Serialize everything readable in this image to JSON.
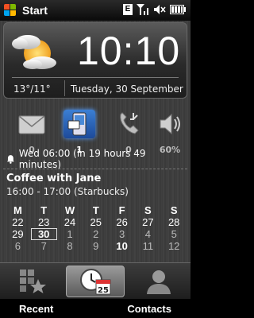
{
  "status_bar": {
    "start_label": "Start",
    "network_badge": "E",
    "icons": [
      "windows-logo",
      "network-badge",
      "signal-icon",
      "volume-icon",
      "battery-icon"
    ]
  },
  "clock": {
    "time": "10:10",
    "temperature": "13°/11°",
    "date": "Tuesday, 30 September",
    "weather_icon": "partly-cloudy-icon"
  },
  "notifications": [
    {
      "name": "email",
      "icon": "email-icon",
      "count": "0"
    },
    {
      "name": "messages",
      "icon": "sms-icon",
      "count": "1"
    },
    {
      "name": "missed-calls",
      "icon": "phone-icon",
      "count": "0"
    },
    {
      "name": "volume",
      "icon": "speaker-icon",
      "count": "60%"
    }
  ],
  "alarm": {
    "text": "Wed 06:00 (in 19 hours 49 minutes)",
    "icon": "bell-icon"
  },
  "appointment": {
    "title": "Coffee with Jane",
    "time": "16:00 - 17:00 (Starbucks)"
  },
  "calendar": {
    "weekdays": [
      "M",
      "T",
      "W",
      "T",
      "F",
      "S",
      "S"
    ],
    "weeks": [
      [
        "22",
        "23",
        "24",
        "25",
        "26",
        "27",
        "28"
      ],
      [
        "29",
        "30",
        "1",
        "2",
        "3",
        "4",
        "5"
      ],
      [
        "6",
        "7",
        "8",
        "9",
        "10",
        "11",
        "12"
      ]
    ],
    "today": "30"
  },
  "tabs": [
    {
      "name": "favorites",
      "icon": "grid-star-icon"
    },
    {
      "name": "home",
      "icon": "clock-calendar-icon",
      "selected": true
    },
    {
      "name": "people",
      "icon": "person-icon"
    }
  ],
  "softkeys": {
    "left": "Recent",
    "right": "Contacts"
  },
  "colors": {
    "accent": "#3b7fd4",
    "background": "#3a3a3a"
  }
}
